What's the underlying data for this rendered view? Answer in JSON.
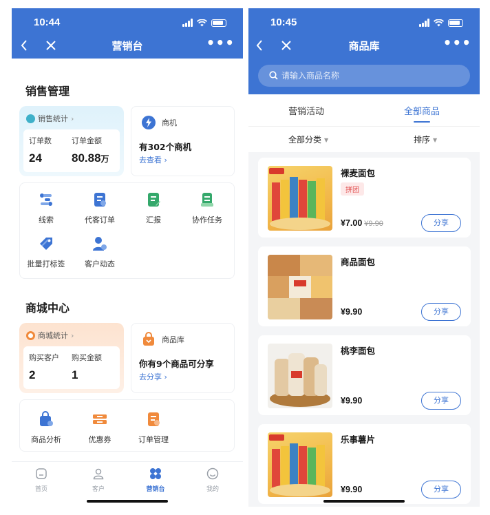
{
  "colors": {
    "primary": "#3d74d3",
    "accent_red": "#e25656",
    "orange": "#f08a3c"
  },
  "left": {
    "status_time": "10:44",
    "nav": {
      "back_icon": "chevron-left-icon",
      "close_icon": "close-icon",
      "title": "营销台",
      "more": "•••"
    },
    "sales": {
      "section_title": "销售管理",
      "stats_card": {
        "title": "销售统计",
        "arrow": "›",
        "col1_label": "订单数",
        "col1_value": "24",
        "col2_label": "订单金额",
        "col2_value": "80.88",
        "col2_unit": "万"
      },
      "opportunity_card": {
        "title": "商机",
        "text": "有302个商机",
        "link": "去查看 ›"
      },
      "tools": [
        "线索",
        "代客订单",
        "汇报",
        "协作任务",
        "批量打标签",
        "客户动态"
      ]
    },
    "mall": {
      "section_title": "商城中心",
      "stats_card": {
        "title": "商城统计",
        "arrow": "›",
        "col1_label": "购买客户",
        "col1_value": "2",
        "col2_label": "购买金额",
        "col2_value": "1"
      },
      "library_card": {
        "title": "商品库",
        "text": "你有9个商品可分享",
        "link": "去分享 ›"
      },
      "tools": [
        "商品分析",
        "优惠券",
        "订单管理"
      ]
    },
    "tabbar": [
      {
        "label": "首页",
        "icon": "home-icon"
      },
      {
        "label": "客户",
        "icon": "user-icon"
      },
      {
        "label": "营销台",
        "icon": "marketing-icon"
      },
      {
        "label": "我的",
        "icon": "smile-icon"
      }
    ]
  },
  "right": {
    "status_time": "10:45",
    "nav": {
      "title": "商品库",
      "more": "•••"
    },
    "search": {
      "placeholder": "请输入商品名称"
    },
    "tabs": [
      "营销活动",
      "全部商品"
    ],
    "filters": [
      "全部分类",
      "排序"
    ],
    "products": [
      {
        "name": "裸麦面包",
        "tag": "拼团",
        "price": "¥7.00",
        "orig_price": "¥9.90",
        "share": "分享"
      },
      {
        "name": "商品面包",
        "price": "¥9.90",
        "share": "分享"
      },
      {
        "name": "桃李面包",
        "price": "¥9.90",
        "share": "分享"
      },
      {
        "name": "乐事薯片",
        "price": "¥9.90",
        "share": "分享"
      }
    ]
  }
}
